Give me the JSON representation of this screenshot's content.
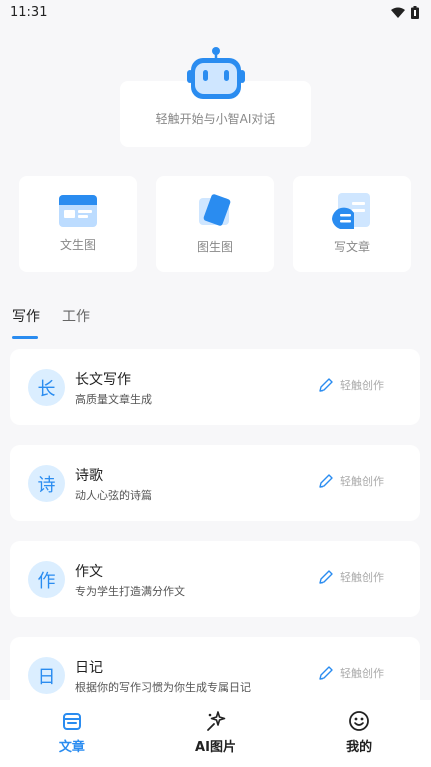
{
  "status_bar": {
    "time": "11:31",
    "icons": [
      "wifi-icon",
      "battery-icon"
    ]
  },
  "hero": {
    "icon": "robot-icon",
    "chat_prompt": "轻触开始与小智AI对话"
  },
  "tools": [
    {
      "label": "文生图",
      "icon": "text-to-image-icon"
    },
    {
      "label": "图生图",
      "icon": "image-to-image-icon"
    },
    {
      "label": "写文章",
      "icon": "write-article-icon"
    }
  ],
  "tabs": [
    {
      "label": "写作",
      "active": true
    },
    {
      "label": "工作",
      "active": false
    }
  ],
  "items": [
    {
      "badge": "长",
      "title": "长文写作",
      "subtitle": "高质量文章生成",
      "action": "轻触创作"
    },
    {
      "badge": "诗",
      "title": "诗歌",
      "subtitle": "动人心弦的诗篇",
      "action": "轻触创作"
    },
    {
      "badge": "作",
      "title": "作文",
      "subtitle": "专为学生打造满分作文",
      "action": "轻触创作"
    },
    {
      "badge": "日",
      "title": "日记",
      "subtitle": "根据你的写作习惯为你生成专属日记",
      "action": "轻触创作"
    }
  ],
  "bottom_nav": [
    {
      "label": "文章",
      "icon": "article-icon",
      "active": true
    },
    {
      "label": "AI图片",
      "icon": "sparkle-image-icon",
      "active": false
    },
    {
      "label": "我的",
      "icon": "smiley-icon",
      "active": false
    }
  ],
  "colors": {
    "accent": "#2a8cf0",
    "icon_bg": "#dbeeff",
    "background": "#f7f7f9"
  }
}
